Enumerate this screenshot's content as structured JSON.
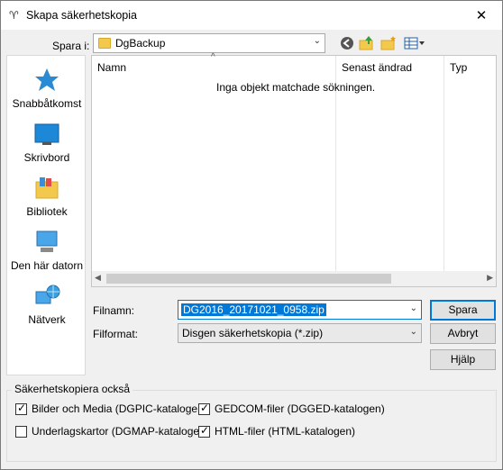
{
  "window": {
    "title": "Skapa säkerhetskopia"
  },
  "location": {
    "label": "Spara i:",
    "folder": "DgBackup"
  },
  "toolbar": {
    "icons": [
      "back-icon",
      "up-folder-icon",
      "new-folder-icon",
      "view-menu-icon"
    ]
  },
  "sidebar": {
    "items": [
      {
        "label": "Snabbåtkomst",
        "icon": "star-icon"
      },
      {
        "label": "Skrivbord",
        "icon": "desktop-icon"
      },
      {
        "label": "Bibliotek",
        "icon": "library-icon"
      },
      {
        "label": "Den här datorn",
        "icon": "computer-icon"
      },
      {
        "label": "Nätverk",
        "icon": "network-icon"
      }
    ]
  },
  "list": {
    "columns": [
      "Namn",
      "Senast ändrad",
      "Typ"
    ],
    "empty_message": "Inga objekt matchade sökningen."
  },
  "filename": {
    "label": "Filnamn:",
    "value": "DG2016_20171021_0958.zip"
  },
  "fileformat": {
    "label": "Filformat:",
    "value": "Disgen säkerhetskopia (*.zip)"
  },
  "buttons": {
    "save": "Spara",
    "cancel": "Avbryt",
    "help": "Hjälp"
  },
  "backup_also": {
    "title": "Säkerhetskopiera också",
    "options": [
      {
        "label": "Bilder och Media (DGPIC-katalogen)",
        "checked": true
      },
      {
        "label": "GEDCOM-filer (DGGED-katalogen)",
        "checked": true
      },
      {
        "label": "Underlagskartor (DGMAP-katalogen)",
        "checked": false
      },
      {
        "label": "HTML-filer (HTML-katalogen)",
        "checked": true
      }
    ]
  },
  "colors": {
    "accent": "#0078d7",
    "folder": "#f2c94c"
  }
}
